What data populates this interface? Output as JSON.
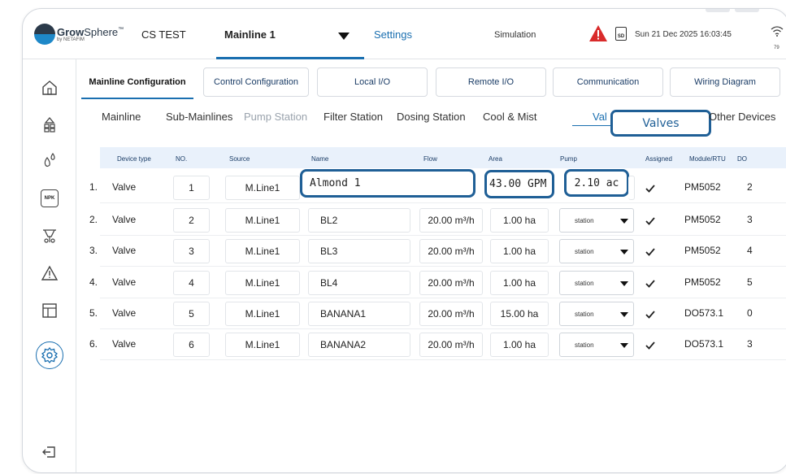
{
  "brand": {
    "name_bold": "Grow",
    "name_rest": "Sphere",
    "tm": "™",
    "sub": "by NETAFIM"
  },
  "header": {
    "farm": "CS TEST",
    "mainline": "Mainline 1",
    "settings": "Settings",
    "simulation": "Simulation",
    "sd_label": "SD",
    "datetime": "Sun 21 Dec 2025  16:03:45",
    "wifi_value": "79"
  },
  "sidebar": {
    "icons": [
      "home-icon",
      "irrigation-icon",
      "fertilizer-drops-icon",
      "npk-icon",
      "filter-icon",
      "warning-icon",
      "layout-icon",
      "settings-icon",
      "logout-icon"
    ],
    "npk_label": "NPK"
  },
  "main_tabs": [
    {
      "label": "Mainline Configuration",
      "active": true
    },
    {
      "label": "Control Configuration",
      "active": false
    },
    {
      "label": "Local I/O",
      "active": false
    },
    {
      "label": "Remote  I/O",
      "active": false
    },
    {
      "label": "Communication",
      "active": false
    },
    {
      "label": "Wiring Diagram",
      "active": false
    }
  ],
  "sub_tabs": [
    {
      "label": "Mainline"
    },
    {
      "label": "Sub-Mainlines"
    },
    {
      "label": "Pump Station",
      "disabled": true
    },
    {
      "label": "Filter Station"
    },
    {
      "label": "Dosing Station"
    },
    {
      "label": "Cool & Mist"
    },
    {
      "label": "Val",
      "active": true
    },
    {
      "label": "Other Devices"
    }
  ],
  "valves_overlay": "Valves",
  "table": {
    "headers": [
      "Device type",
      "NO.",
      "Source",
      "Name",
      "Flow",
      "Area",
      "Pump",
      "Assigned",
      "Module/RTU",
      "DO"
    ],
    "rows": [
      {
        "idx": "1.",
        "type": "Valve",
        "no": "1",
        "source": "M.Line1",
        "name": "Almond 1",
        "flow": "",
        "area": "43.00 GPM",
        "pump": "2.10 ac",
        "assigned": true,
        "module": "PM5052",
        "do": "2"
      },
      {
        "idx": "2.",
        "type": "Valve",
        "no": "2",
        "source": "M.Line1",
        "name": "BL2",
        "flow": "20.00 m³/h",
        "area": "1.00 ha",
        "pump": "station",
        "assigned": true,
        "module": "PM5052",
        "do": "3"
      },
      {
        "idx": "3.",
        "type": "Valve",
        "no": "3",
        "source": "M.Line1",
        "name": "BL3",
        "flow": "20.00 m³/h",
        "area": "1.00 ha",
        "pump": "station",
        "assigned": true,
        "module": "PM5052",
        "do": "4"
      },
      {
        "idx": "4.",
        "type": "Valve",
        "no": "4",
        "source": "M.Line1",
        "name": "BL4",
        "flow": "20.00 m³/h",
        "area": "1.00 ha",
        "pump": "station",
        "assigned": true,
        "module": "PM5052",
        "do": "5"
      },
      {
        "idx": "5.",
        "type": "Valve",
        "no": "5",
        "source": "M.Line1",
        "name": "BANANA1",
        "flow": "20.00 m³/h",
        "area": "15.00 ha",
        "pump": "station",
        "assigned": true,
        "module": "DO573.1",
        "do": "0"
      },
      {
        "idx": "6.",
        "type": "Valve",
        "no": "6",
        "source": "M.Line1",
        "name": "BANANA2",
        "flow": "20.00 m³/h",
        "area": "1.00 ha",
        "pump": "station",
        "assigned": true,
        "module": "DO573.1",
        "do": "3"
      }
    ]
  },
  "colors": {
    "accent": "#1a6fb0",
    "highlight": "#1f5f96",
    "header_bg": "#e9f1fb",
    "alert": "#d92b2b"
  }
}
